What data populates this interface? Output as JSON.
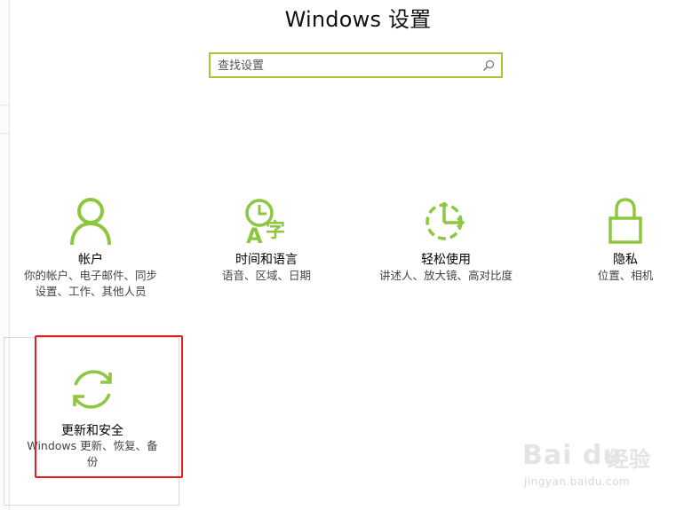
{
  "window": {
    "title": "Windows 设置"
  },
  "search": {
    "placeholder": "查找设置",
    "icon": "search-icon"
  },
  "accent_color": "#8dc63f",
  "tiles": [
    {
      "name": "帐户",
      "desc_lines": [
        "你的帐户、电子邮件、同步",
        "设置、工作、其他人员"
      ],
      "icon": "person-icon"
    },
    {
      "name": "时间和语言",
      "desc_lines": [
        "语音、区域、日期"
      ],
      "icon": "time-language-icon"
    },
    {
      "name": "轻松使用",
      "desc_lines": [
        "讲述人、放大镜、高对比度"
      ],
      "icon": "ease-of-access-icon"
    },
    {
      "name": "隐私",
      "desc_lines": [
        "位置、相机"
      ],
      "icon": "lock-icon"
    },
    {
      "name": "更新和安全",
      "desc_lines": [
        "Windows 更新、恢复、备",
        "份"
      ],
      "icon": "sync-icon"
    }
  ],
  "highlight_color": "#e02020",
  "watermark": {
    "logo": "Bai du",
    "cn": "经验",
    "url": "jingyan.baidu.com"
  }
}
